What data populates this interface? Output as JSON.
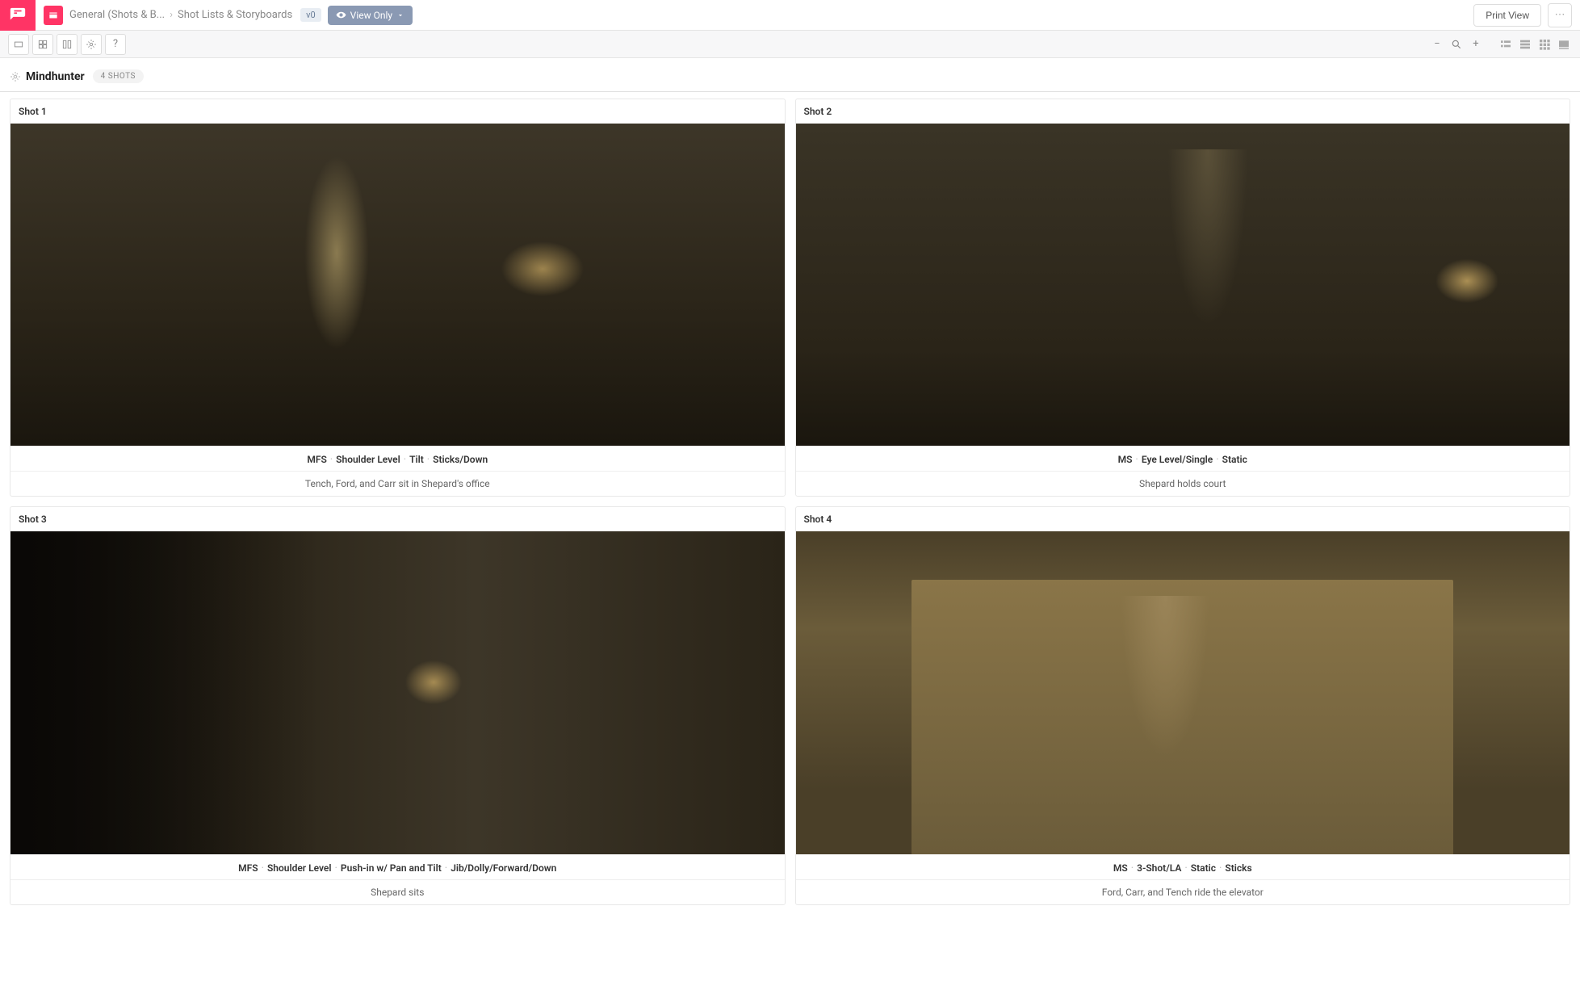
{
  "header": {
    "breadcrumb": [
      {
        "label": "General (Shots & B..."
      },
      {
        "label": "Shot Lists & Storyboards"
      }
    ],
    "version": "v0",
    "view_mode": "View Only",
    "print_label": "Print View"
  },
  "page": {
    "title": "Mindhunter",
    "shot_count": "4 SHOTS"
  },
  "shots": [
    {
      "label": "Shot 1",
      "tags": [
        "MFS",
        "Shoulder Level",
        "Tilt",
        "Sticks/Down"
      ],
      "description": "Tench, Ford, and Carr sit in Shepard's office",
      "scene_class": "scene1"
    },
    {
      "label": "Shot 2",
      "tags": [
        "MS",
        "Eye Level/Single",
        "Static"
      ],
      "description": "Shepard holds court",
      "scene_class": "scene2"
    },
    {
      "label": "Shot 3",
      "tags": [
        "MFS",
        "Shoulder Level",
        "Push-in w/ Pan and Tilt",
        "Jib/Dolly/Forward/Down"
      ],
      "description": "Shepard sits",
      "scene_class": "scene3"
    },
    {
      "label": "Shot 4",
      "tags": [
        "MS",
        "3-Shot/LA",
        "Static",
        "Sticks"
      ],
      "description": "Ford, Carr, and Tench ride the elevator",
      "scene_class": "scene4"
    }
  ]
}
